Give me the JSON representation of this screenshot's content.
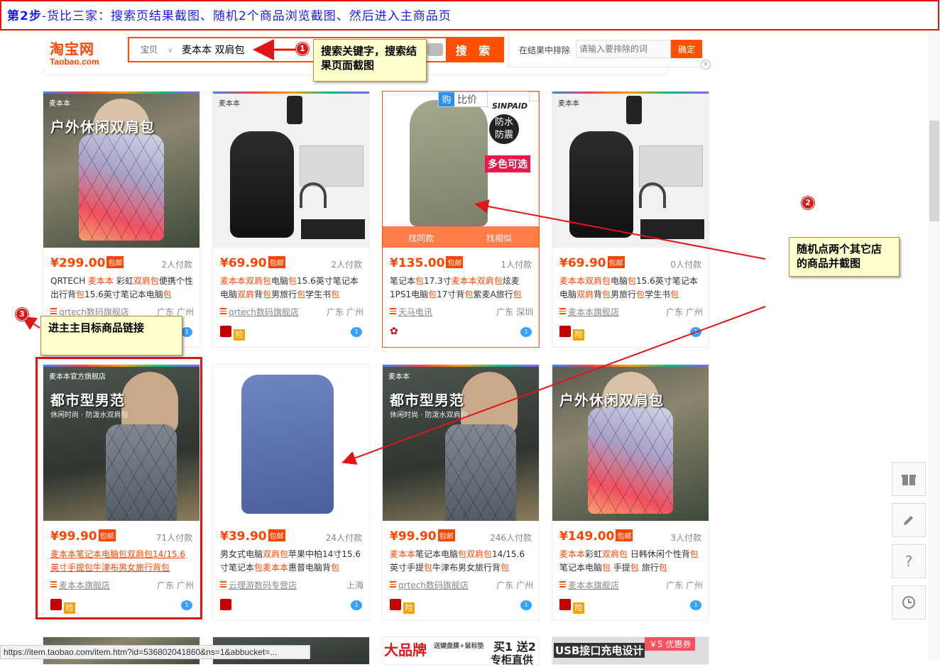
{
  "banner": {
    "prefix": "第2步",
    "text": "-货比三家：搜索页结果截图、随机2个商品浏览截图、然后进入主商品页"
  },
  "header": {
    "logo_cn": "淘宝网",
    "logo_en": "Taobao.com",
    "category": "宝贝",
    "search_value": "麦本本 双肩包",
    "search_button": "搜 索",
    "exclude_label": "在结果中排除",
    "exclude_placeholder": "请输入要排除的词",
    "exclude_button": "确定"
  },
  "products_row1": [
    {
      "price": "¥299.00",
      "baoyou": "包邮",
      "sales": "2人付款",
      "title_plain": "QRTECH 麦本本 彩虹双肩包便携个性出行背包15.6英寸笔记本电脑包",
      "shop": "qrtech数码旗舰店",
      "location": "广东 广州",
      "hero": "户外休闲双肩包"
    },
    {
      "price": "¥69.90",
      "baoyou": "包邮",
      "sales": "2人付款",
      "title_plain": "麦本本双肩包电脑包15.6英寸笔记本电脑双肩背包男旅行包学生书包",
      "shop": "qrtech数码旗舰店",
      "location": "广东 广州"
    },
    {
      "price": "¥135.00",
      "baoyou": "包邮",
      "sales": "1人付款",
      "title_plain": "笔记本包17.3寸麦本本双肩包炫麦1PS1电脑包17寸背包紫麦A旅行包",
      "shop": "天马电讯",
      "location": "广东 深圳",
      "compare": "比价",
      "gou": "购",
      "find_same": "找同款",
      "find_similar": "找相似",
      "brand": "SINPAID",
      "badge1": "防水",
      "badge2": "防震",
      "multicolor": "多色可选"
    },
    {
      "price": "¥69.90",
      "baoyou": "包邮",
      "sales": "0人付款",
      "title_plain": "麦本本双肩包电脑包15.6英寸笔记本电脑双肩背包男旅行包学生书包",
      "shop": "麦本本旗舰店",
      "location": "广东 广州"
    }
  ],
  "products_row2": [
    {
      "price": "¥99.90",
      "baoyou": "包邮",
      "sales": "71人付款",
      "title_plain": "麦本本笔记本电脑包双肩包14/15.6英寸手提包牛津布男女旅行背包",
      "shop": "麦本本旗舰店",
      "location": "广东 广州",
      "hero": "都市型男范",
      "hero_sub": "休闲时尚 · 防泼水双肩包",
      "brand_tag": "麦本本官方旗舰店"
    },
    {
      "price": "¥39.90",
      "baoyou": "包邮",
      "sales": "24人付款",
      "title_plain": "男女式电脑双肩包苹果中柏14寸15.6寸笔记本包麦本本惠普电脑背包",
      "shop": "云理游数码专营店",
      "location": "上海"
    },
    {
      "price": "¥99.90",
      "baoyou": "包邮",
      "sales": "246人付款",
      "title_plain": "麦本本笔记本电脑包双肩包14/15.6英寸手提包牛津布男女旅行背包",
      "shop": "qrtech数码旗舰店",
      "location": "广东 广州",
      "hero": "都市型男范",
      "hero_sub": "休闲时尚 · 防泼水双肩包"
    },
    {
      "price": "¥149.00",
      "baoyou": "包邮",
      "sales": "3人付款",
      "title_plain": "麦本本彩虹双肩包 日韩休闲个性背包笔记本电脑包 手提包 旅行包",
      "shop": "麦本本旗舰店",
      "location": "广东 广州",
      "hero": "户外休闲双肩包"
    }
  ],
  "partial_row": {
    "card3_a": "大品牌",
    "card3_b": "送键盘膜+鼠标垫",
    "card3_c": "买1 送2",
    "card3_d": "专柜直供",
    "card4": "USB接口充电设计",
    "coupon": "￥5 优惠券"
  },
  "annotations": {
    "c1": "搜索关键字，搜索结果页面截图",
    "c2": "随机点两个其它店的商品并截图",
    "c3": "进主主目标商品链接",
    "n1": "1",
    "n2": "2",
    "n3": "3"
  },
  "xian": "险",
  "ww": "1",
  "close_x": "×",
  "sidebar": {
    "gift_icon": "gift-icon",
    "edit_icon": "edit-icon",
    "help": "?",
    "history_icon": "clock-icon"
  },
  "status_url": "https://item.taobao.com/item.htm?id=536802041860&ns=1&abbucket=..."
}
